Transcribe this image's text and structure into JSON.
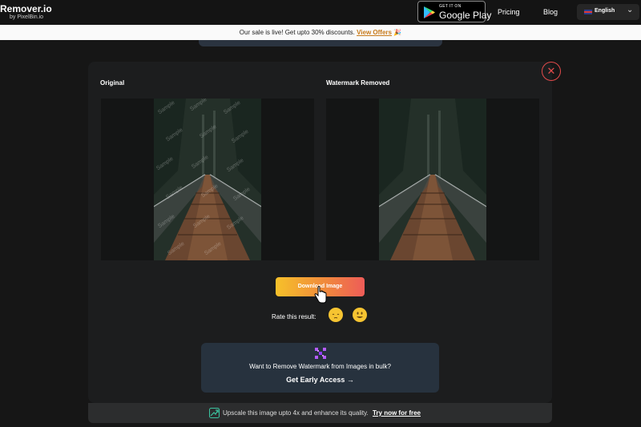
{
  "header": {
    "logo_main": "Remover.io",
    "logo_sub": "by PixelBin.io",
    "gplay_small": "GET IT ON",
    "gplay_big": "Google Play",
    "nav": [
      "Pricing",
      "Blog"
    ],
    "language": "English"
  },
  "banner": {
    "text": "Our sale is live! Get upto 30% discounts.",
    "link": "View Offers"
  },
  "modal": {
    "close_icon": "close-icon",
    "original_title": "Original",
    "removed_title": "Watermark Removed",
    "watermark_text": "Sample",
    "download_label": "Download Image",
    "rate_label": "Rate this result:",
    "bulk_text": "Want to Remove Watermark from Images in bulk?",
    "bulk_cta": "Get Early Access →"
  },
  "bottom_bar": {
    "text": "Upscale this image upto 4x and enhance its quality.",
    "link": "Try now for free"
  },
  "colors": {
    "accent_gradient_start": "#f6c12a",
    "accent_gradient_end": "#ee5c58",
    "close_red": "#e34b4b",
    "card_bg": "#27323e"
  }
}
